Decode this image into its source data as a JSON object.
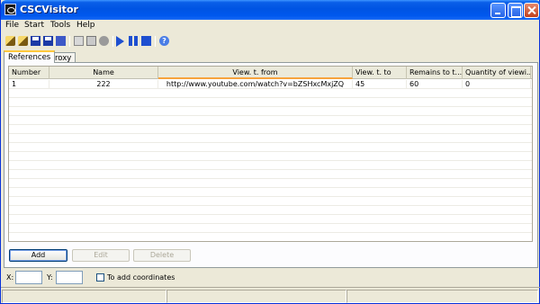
{
  "window": {
    "title": "CSCVisitor"
  },
  "menu": {
    "file": "File",
    "start": "Start",
    "tools": "Tools",
    "help": "Help"
  },
  "tabs": [
    {
      "label": "References",
      "active": true
    },
    {
      "label": "Proxy",
      "active": false
    }
  ],
  "grid": {
    "columns": [
      "Number",
      "Name",
      "View. t. from",
      "View. t. to",
      "Remains to t...",
      "Quantity of viewi..."
    ],
    "rows": [
      [
        "1",
        "222",
        "http://www.youtube.com/watch?v=bZSHxcMxjZQ",
        "45",
        "60",
        "0"
      ]
    ],
    "sorted_column": "View. t. from"
  },
  "buttons": {
    "add": "Add",
    "edit": "Edit",
    "delete": "Delete"
  },
  "coordinates": {
    "x_label": "X:",
    "y_label": "Y:",
    "x_value": "",
    "y_value": "",
    "checkbox_label": "To add coordinates",
    "checked": false
  },
  "colors": {
    "titlebar": "#0054e3",
    "sort_indicator": "#f7a33d",
    "window_bg": "#ece9d8"
  }
}
